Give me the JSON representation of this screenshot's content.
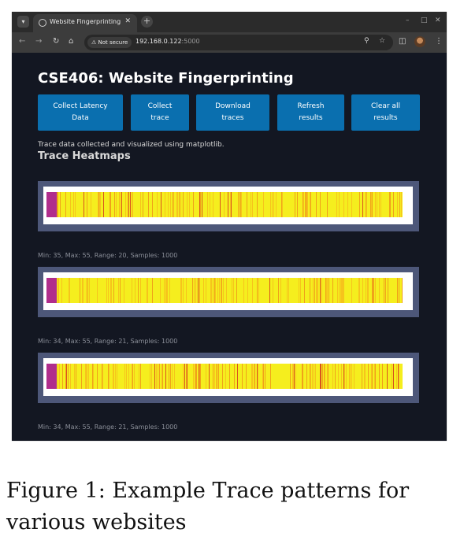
{
  "browser": {
    "tab_title": "Website Fingerprinting",
    "not_secure_label": "Not secure",
    "url_host": "192.168.0.122",
    "url_port": ":5000"
  },
  "page": {
    "heading": "CSE406: Website Fingerprinting",
    "buttons": [
      {
        "line1": "Collect Latency",
        "line2": "Data"
      },
      {
        "line1": "Collect",
        "line2": "trace"
      },
      {
        "line1": "Download",
        "line2": "traces"
      },
      {
        "line1": "Refresh",
        "line2": "results"
      },
      {
        "line1": "Clear all",
        "line2": "results"
      }
    ],
    "info_text": "Trace data collected and visualized using matplotlib.",
    "section_title": "Trace Heatmaps",
    "heatmaps": [
      {
        "stats": "Min: 35, Max: 55, Range: 20, Samples: 1000"
      },
      {
        "stats": "Min: 34, Max: 55, Range: 21, Samples: 1000"
      },
      {
        "stats": "Min: 34, Max: 55, Range: 21, Samples: 1000"
      }
    ],
    "colors": {
      "accent": "#0a6faf",
      "background": "#131722",
      "heatmap_frame": "#4d5779",
      "heat_low": "#f5ee1e",
      "heat_high": "#b02d8c"
    }
  },
  "caption": "Figure 1: Example Trace patterns for various websites"
}
